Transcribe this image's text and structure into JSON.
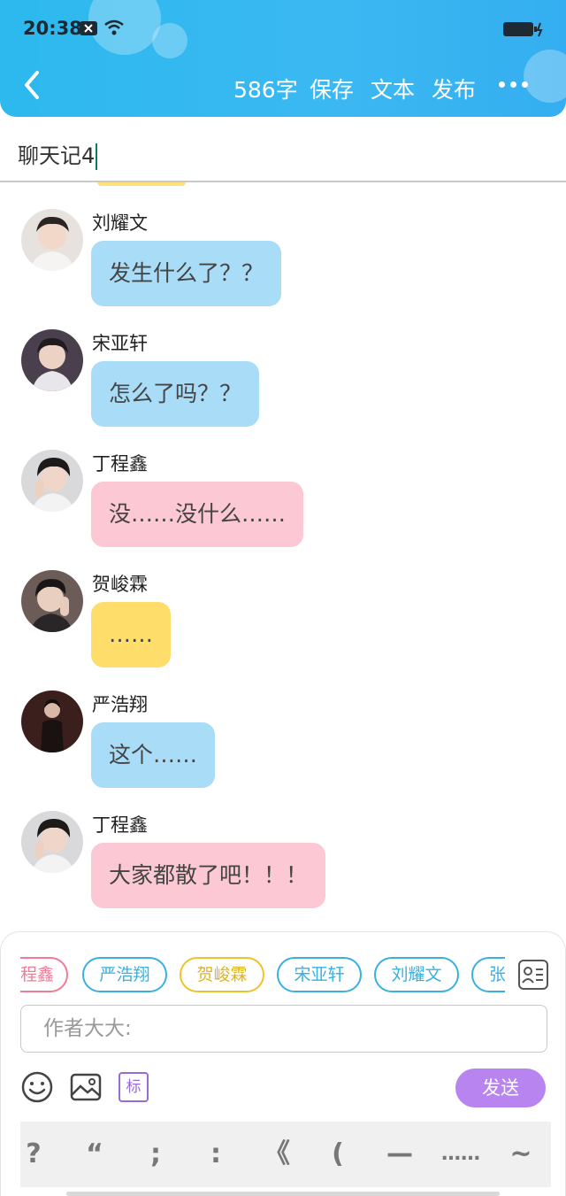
{
  "status": {
    "time": "20:38"
  },
  "toolbar": {
    "word_count": "586字",
    "save_label": "保存",
    "text_label": "文本",
    "publish_label": "发布"
  },
  "title": {
    "value": "聊天记4"
  },
  "messages": [
    {
      "name": "刘耀文",
      "text": "发生什么了？？",
      "color": "blue"
    },
    {
      "name": "宋亚轩",
      "text": "怎么了吗？？",
      "color": "blue"
    },
    {
      "name": "丁程鑫",
      "text": "没……没什么……",
      "color": "pink"
    },
    {
      "name": "贺峻霖",
      "text": "……",
      "color": "yellow"
    },
    {
      "name": "严浩翔",
      "text": "这个……",
      "color": "blue"
    },
    {
      "name": "丁程鑫",
      "text": "大家都散了吧！！！",
      "color": "pink"
    }
  ],
  "characters": [
    {
      "label": "程鑫",
      "color": "pink"
    },
    {
      "label": "严浩翔",
      "color": "blue"
    },
    {
      "label": "贺峻霖",
      "color": "yellow"
    },
    {
      "label": "宋亚轩",
      "color": "blue"
    },
    {
      "label": "刘耀文",
      "color": "blue"
    },
    {
      "label": "张",
      "color": "blue"
    }
  ],
  "composer": {
    "placeholder": "作者大大:",
    "tag_label": "标",
    "send_label": "发送"
  },
  "punctuation": [
    "?",
    "“",
    ";",
    ":",
    "《",
    "(",
    "—",
    "……",
    "~"
  ],
  "colors": {
    "header": "#2db9ee",
    "bubble_blue": "#a8dcf7",
    "bubble_pink": "#fcc8d4",
    "bubble_yellow": "#fedd6b",
    "send": "#b784f0"
  }
}
